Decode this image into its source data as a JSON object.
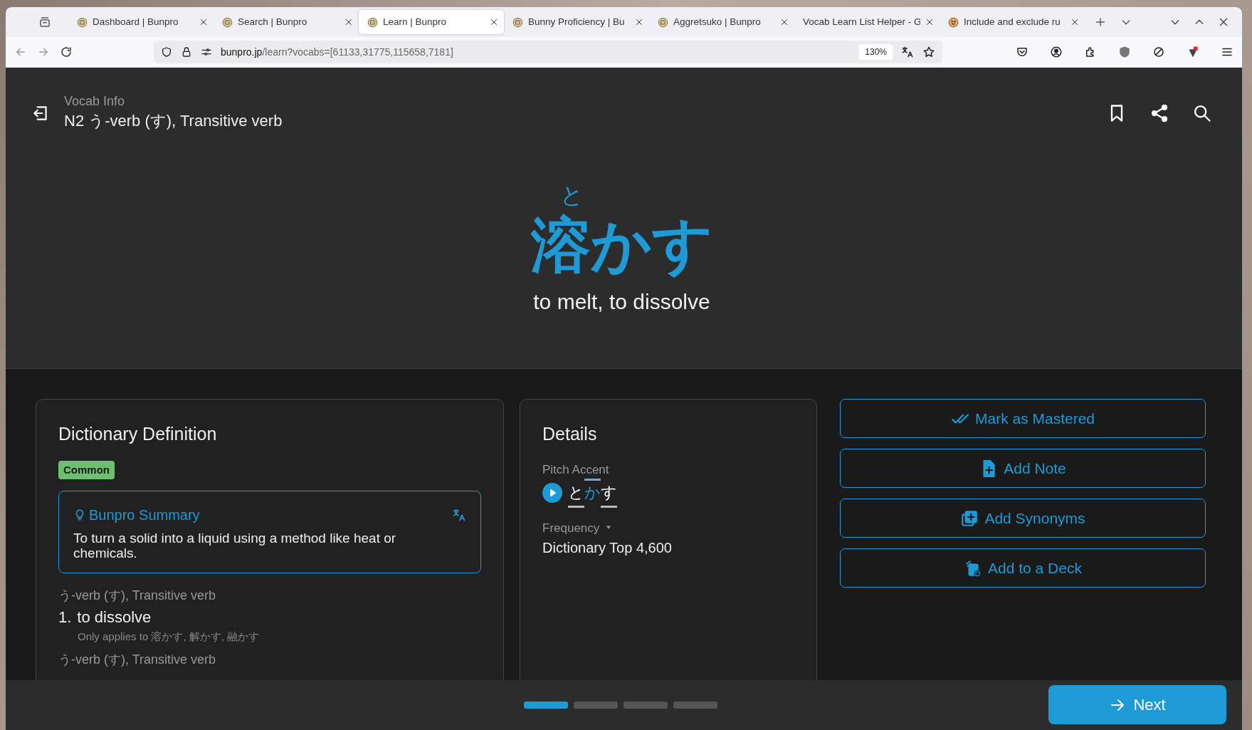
{
  "browser": {
    "tabs": [
      {
        "title": "Dashboard | Bunpro",
        "kind": "logo",
        "selected": false
      },
      {
        "title": "Search | Bunpro",
        "kind": "logo",
        "selected": false
      },
      {
        "title": "Learn | Bunpro",
        "kind": "logo",
        "selected": true
      },
      {
        "title": "Bunny Proficiency | Bu",
        "kind": "logo",
        "selected": false
      },
      {
        "title": "Aggretsuko | Bunpro",
        "kind": "logo",
        "selected": false
      },
      {
        "title": "Vocab Learn List Helper - G",
        "kind": "plain",
        "selected": false
      },
      {
        "title": "Include and exclude ru",
        "kind": "face",
        "selected": false
      }
    ],
    "url_host": "bunpro.jp",
    "url_path": "/learn?vocabs=[61133,31775,115658,7181]",
    "zoom": "130%"
  },
  "header": {
    "subtitle": "Vocab Info",
    "title": "N2 う-verb (す), Transitive verb"
  },
  "word": {
    "reading": "と",
    "text": "溶かす",
    "meaning": "to melt, to dissolve"
  },
  "dictionary": {
    "title": "Dictionary Definition",
    "tag": "Common",
    "summary": {
      "title": "Bunpro Summary",
      "text": "To turn a solid into a liquid using a method like heat or chemicals."
    },
    "senses": [
      {
        "pos": "う-verb (す), Transitive verb",
        "number": "1.",
        "meaning": "to dissolve",
        "note": "Only applies to 溶かす, 解かす, 融かす"
      },
      {
        "pos": "う-verb (す), Transitive verb"
      }
    ]
  },
  "details": {
    "title": "Details",
    "pitch_label": "Pitch Accent",
    "pitch": [
      {
        "text": "と",
        "kind": "low"
      },
      {
        "text": "か",
        "kind": "high"
      },
      {
        "text": "す",
        "kind": "low"
      }
    ],
    "frequency_label": "Frequency",
    "frequency": "Dictionary Top 4,600"
  },
  "actions": [
    {
      "label": "Mark as Mastered",
      "kind": "mastered"
    },
    {
      "label": "Add Note",
      "kind": "note"
    },
    {
      "label": "Add Synonyms",
      "kind": "synonyms"
    },
    {
      "label": "Add to a Deck",
      "kind": "deck"
    }
  ],
  "progress": [
    {
      "selected": true
    },
    {
      "selected": false
    },
    {
      "selected": false
    },
    {
      "selected": false
    }
  ],
  "next_button": "Next"
}
